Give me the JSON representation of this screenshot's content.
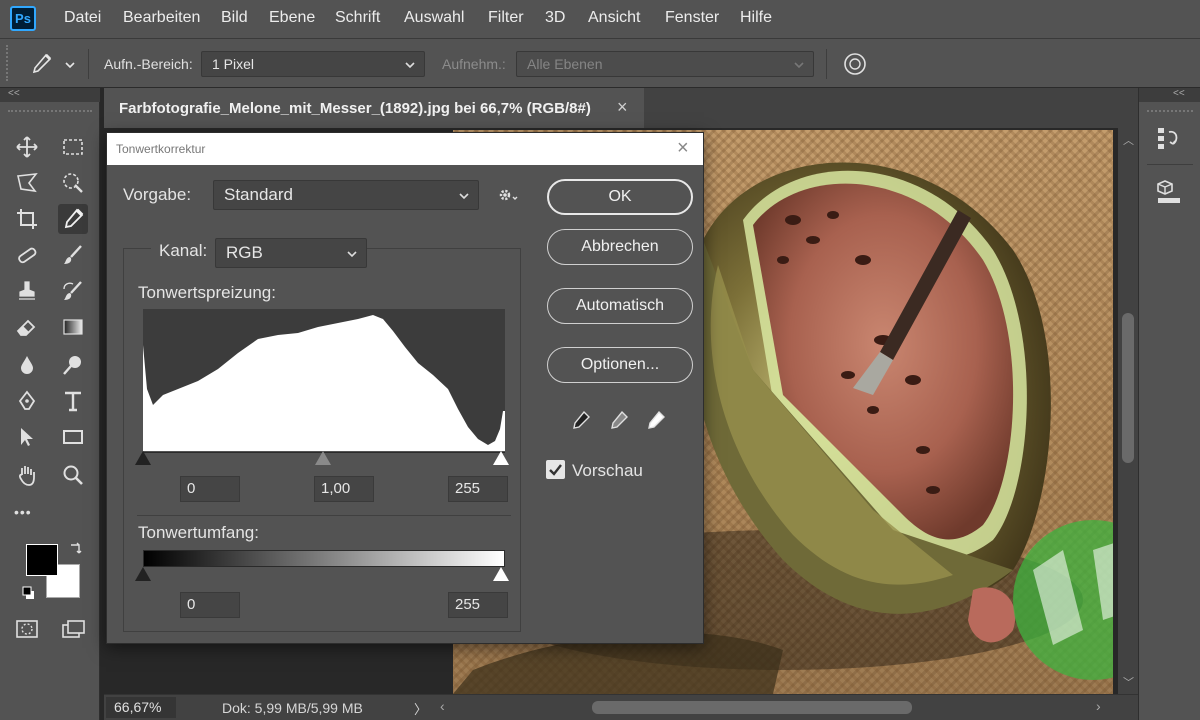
{
  "app": {
    "logo_text": "Ps"
  },
  "menu": [
    "Datei",
    "Bearbeiten",
    "Bild",
    "Ebene",
    "Schrift",
    "Auswahl",
    "Filter",
    "3D",
    "Ansicht",
    "Fenster",
    "Hilfe"
  ],
  "options_bar": {
    "sample_size_label": "Aufn.-Bereich:",
    "sample_size_value": "1 Pixel",
    "sample_label": "Aufnehm.:",
    "sample_value": "Alle Ebenen"
  },
  "panels": {
    "collapse_left": "<<",
    "collapse_right": "<<",
    "more_tools": "•••"
  },
  "document": {
    "tab_title": "Farbfotografie_Melone_mit_Messer_(1892).jpg bei 66,7% (RGB/8#)",
    "tab_close": "×"
  },
  "status": {
    "zoom": "66,67%",
    "doc_info": "Dok: 5,99 MB/5,99 MB",
    "arrow": "〉"
  },
  "dialog": {
    "title": "Tonwertkorrektur",
    "close": "×",
    "preset_label": "Vorgabe:",
    "preset_value": "Standard",
    "channel_label": "Kanal:",
    "channel_value": "RGB",
    "input_levels_label": "Tonwertspreizung:",
    "input_black": "0",
    "input_gamma": "1,00",
    "input_white": "255",
    "output_levels_label": "Tonwertumfang:",
    "output_black": "0",
    "output_white": "255",
    "buttons": {
      "ok": "OK",
      "cancel": "Abbrechen",
      "auto": "Automatisch",
      "options": "Optionen..."
    },
    "preview_label": "Vorschau",
    "preview_checked": true
  },
  "colors": {
    "accent": "#31a8ff",
    "panel": "#535353",
    "dark": "#282828",
    "foreground": "#000000",
    "background": "#ffffff"
  }
}
